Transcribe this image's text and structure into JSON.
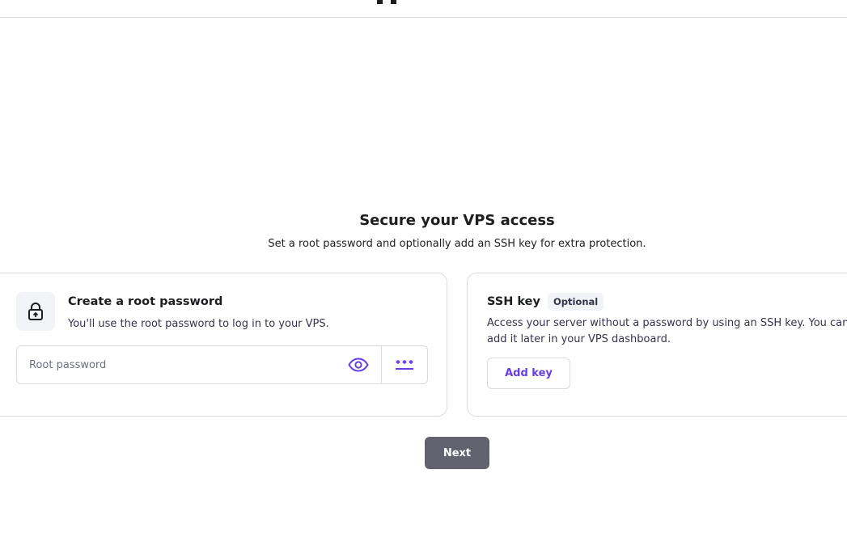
{
  "header": {
    "logo_icon": "brand-logo-icon"
  },
  "page": {
    "title": "Secure your VPS access",
    "subtitle": "Set a root password and optionally add an SSH key for extra protection."
  },
  "password_card": {
    "icon": "lock-icon",
    "title": "Create a root password",
    "description": "You'll use the root password to log in to your VPS.",
    "input": {
      "placeholder": "Root password",
      "value": ""
    },
    "show_icon": "eye-icon",
    "generate_icon": "generate-password-icon"
  },
  "ssh_card": {
    "title": "SSH key",
    "badge": "Optional",
    "description": "Access your server without a password by using an SSH key. You can add it later in your VPS dashboard.",
    "add_button": "Add key"
  },
  "footer": {
    "next_button": "Next"
  },
  "colors": {
    "accent": "#673de6",
    "next_button_bg": "#62626f",
    "border": "#dadce0"
  }
}
